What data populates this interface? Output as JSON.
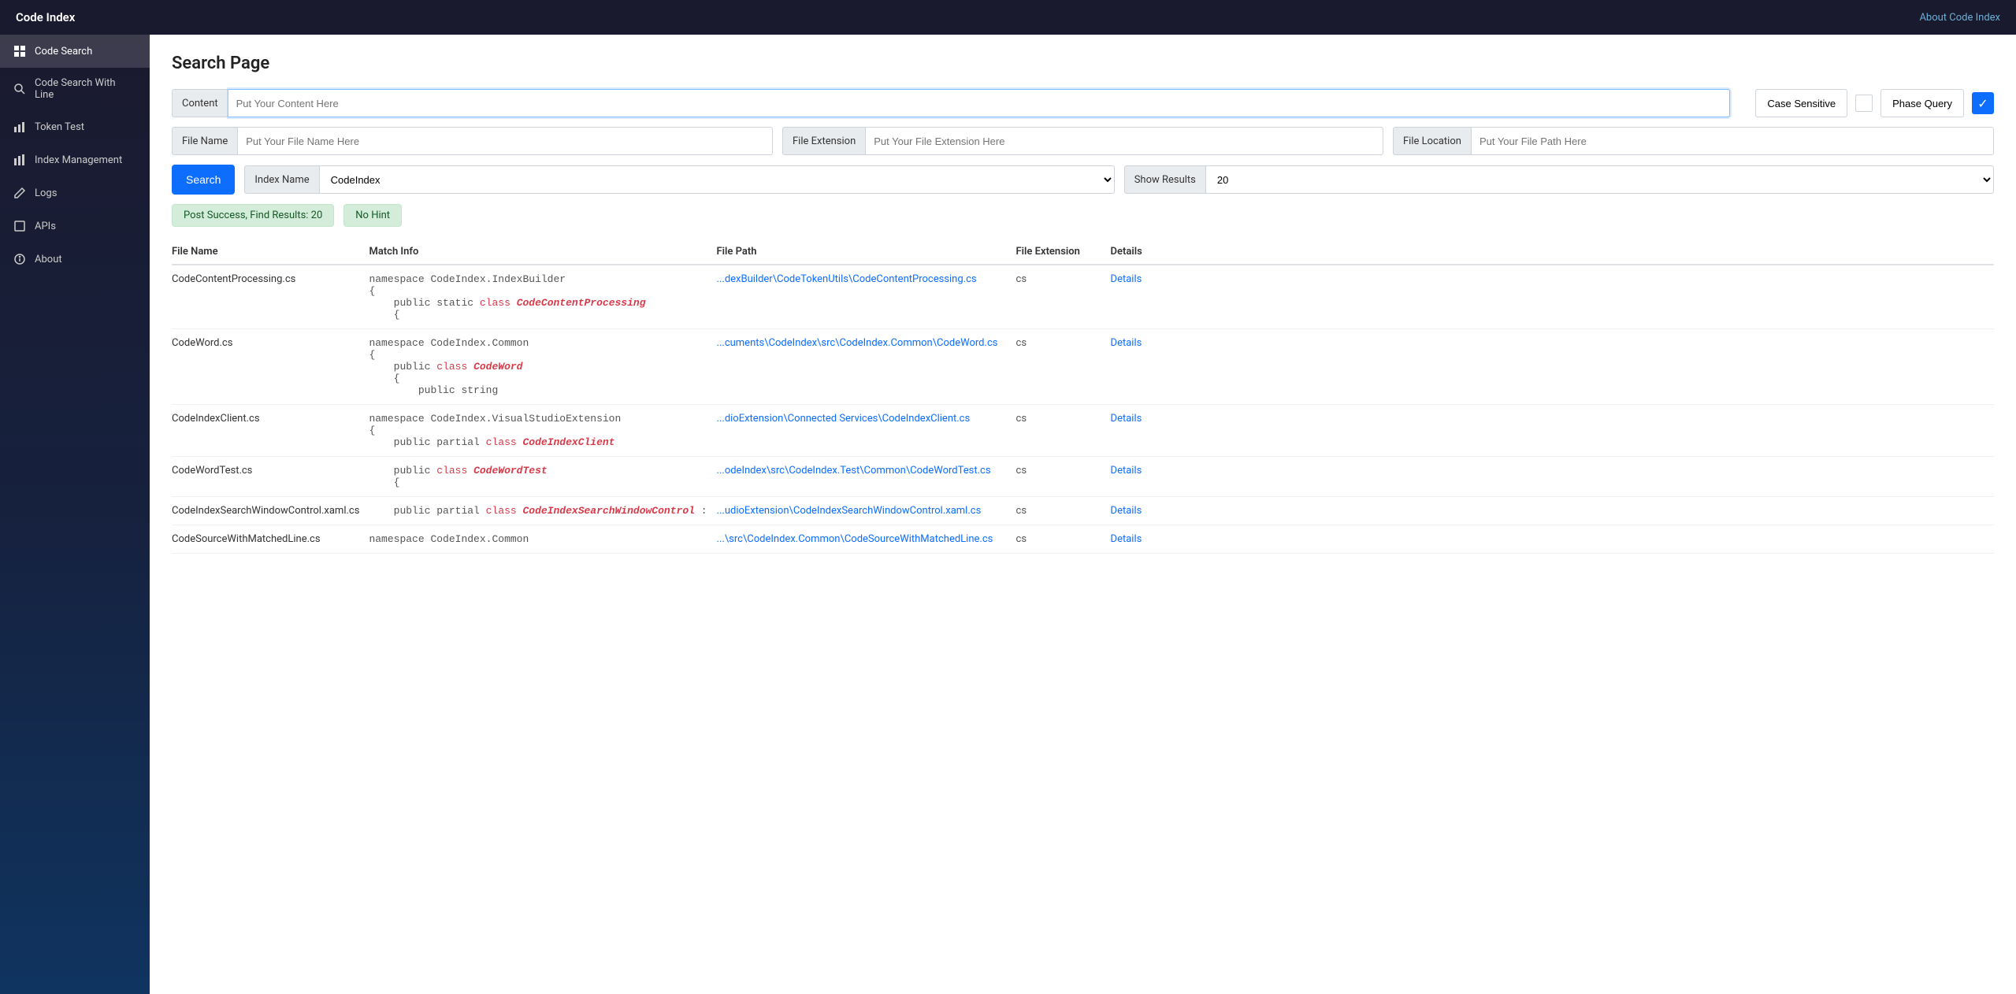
{
  "app": {
    "title": "Code Index",
    "about_link": "About Code Index"
  },
  "sidebar": {
    "items": [
      {
        "id": "code-search",
        "label": "Code Search",
        "icon": "grid",
        "active": true
      },
      {
        "id": "code-search-line",
        "label": "Code Search With Line",
        "icon": "search",
        "active": false
      },
      {
        "id": "token-test",
        "label": "Token Test",
        "icon": "bar-chart",
        "active": false
      },
      {
        "id": "index-management",
        "label": "Index Management",
        "icon": "bar-chart-2",
        "active": false
      },
      {
        "id": "logs",
        "label": "Logs",
        "icon": "edit",
        "active": false
      },
      {
        "id": "apis",
        "label": "APIs",
        "icon": "box",
        "active": false
      },
      {
        "id": "about",
        "label": "About",
        "icon": "info",
        "active": false
      }
    ]
  },
  "main": {
    "page_title": "Search Page",
    "form": {
      "content_label": "Content",
      "content_placeholder": "Put Your Content Here",
      "file_name_label": "File Name",
      "file_name_placeholder": "Put Your File Name Here",
      "file_extension_label": "File Extension",
      "file_extension_placeholder": "Put Your File Extension Here",
      "file_location_label": "File Location",
      "file_location_placeholder": "Put Your File Path Here",
      "index_name_label": "Index Name",
      "index_name_value": "CodeIndex",
      "show_results_label": "Show Results",
      "show_results_value": "20",
      "case_sensitive_label": "Case Sensitive",
      "phase_query_label": "Phase Query",
      "search_button": "Search"
    },
    "status": {
      "success_text": "Post Success, Find Results: 20",
      "hint_text": "No Hint"
    },
    "table": {
      "headers": [
        "File Name",
        "Match Info",
        "File Path",
        "File Extension",
        "Details"
      ],
      "rows": [
        {
          "file_name": "CodeContentProcessing.cs",
          "match_info_lines": [
            "namespace CodeIndex.IndexBuilder",
            "{",
            "    public static class CodeContentProcessing",
            "    {"
          ],
          "match_keyword": "class",
          "match_classname": "CodeContentProcessing",
          "file_path": "...dexBuilder\\CodeTokenUtils\\CodeContentProcessing.cs",
          "extension": "cs",
          "details": "Details"
        },
        {
          "file_name": "CodeWord.cs",
          "match_info_lines": [
            "namespace CodeIndex.Common",
            "{",
            "    public class CodeWord",
            "    {",
            "        public string"
          ],
          "match_keyword": "class",
          "match_classname": "CodeWord",
          "file_path": "...cuments\\CodeIndex\\src\\CodeIndex.Common\\CodeWord.cs",
          "extension": "cs",
          "details": "Details"
        },
        {
          "file_name": "CodeIndexClient.cs",
          "match_info_lines": [
            "namespace CodeIndex.VisualStudioExtension",
            "{",
            "    public partial class CodeIndexClient"
          ],
          "match_keyword": "class",
          "match_classname": "CodeIndexClient",
          "file_path": "...dioExtension\\Connected Services\\CodeIndexClient.cs",
          "extension": "cs",
          "details": "Details"
        },
        {
          "file_name": "CodeWordTest.cs",
          "match_info_lines": [
            "    public class CodeWordTest",
            "    {"
          ],
          "match_keyword": "class",
          "match_classname": "CodeWordTest",
          "file_path": "...odeIndex\\src\\CodeIndex.Test\\Common\\CodeWordTest.cs",
          "extension": "cs",
          "details": "Details"
        },
        {
          "file_name": "CodeIndexSearchWindowControl.xaml.cs",
          "match_info_lines": [
            "    public partial class CodeIndexSearchWindowControl :"
          ],
          "match_keyword": "class",
          "match_classname": "CodeIndexSearchWindowControl",
          "file_path": "...udioExtension\\CodeIndexSearchWindowControl.xaml.cs",
          "extension": "cs",
          "details": "Details"
        },
        {
          "file_name": "CodeSourceWithMatchedLine.cs",
          "match_info_lines": [
            "namespace CodeIndex.Common"
          ],
          "match_keyword": "",
          "match_classname": "",
          "file_path": "...\\src\\CodeIndex.Common\\CodeSourceWithMatchedLine.cs",
          "extension": "cs",
          "details": "Details"
        }
      ]
    }
  }
}
